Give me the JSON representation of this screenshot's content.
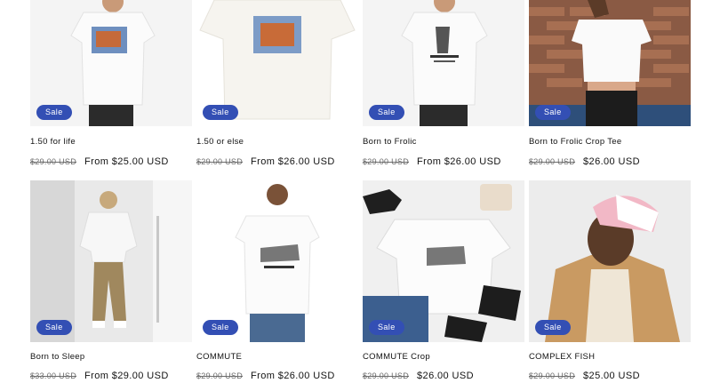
{
  "products": [
    {
      "title": "1.50 for life",
      "badge": "Sale",
      "regular_price": "$29.00 USD",
      "sale_price": "From $25.00 USD"
    },
    {
      "title": "1.50 or else",
      "badge": "Sale",
      "regular_price": "$29.00 USD",
      "sale_price": "From $26.00 USD"
    },
    {
      "title": "Born to Frolic",
      "badge": "Sale",
      "regular_price": "$29.00 USD",
      "sale_price": "From $26.00 USD"
    },
    {
      "title": "Born to Frolic Crop Tee",
      "badge": "Sale",
      "regular_price": "$29.00 USD",
      "sale_price": "$26.00 USD"
    },
    {
      "title": "Born to Sleep",
      "badge": "Sale",
      "regular_price": "$33.00 USD",
      "sale_price": "From $29.00 USD"
    },
    {
      "title": "COMMUTE",
      "badge": "Sale",
      "regular_price": "$29.00 USD",
      "sale_price": "From $26.00 USD"
    },
    {
      "title": "COMMUTE Crop",
      "badge": "Sale",
      "regular_price": "$29.00 USD",
      "sale_price": "$26.00 USD"
    },
    {
      "title": "COMPLEX FISH",
      "badge": "Sale",
      "regular_price": "$29.00 USD",
      "sale_price": "$25.00 USD"
    }
  ],
  "theme": {
    "badge_color": "#334fb4",
    "text_color": "#121212",
    "muted_color": "#6b6b6b"
  }
}
